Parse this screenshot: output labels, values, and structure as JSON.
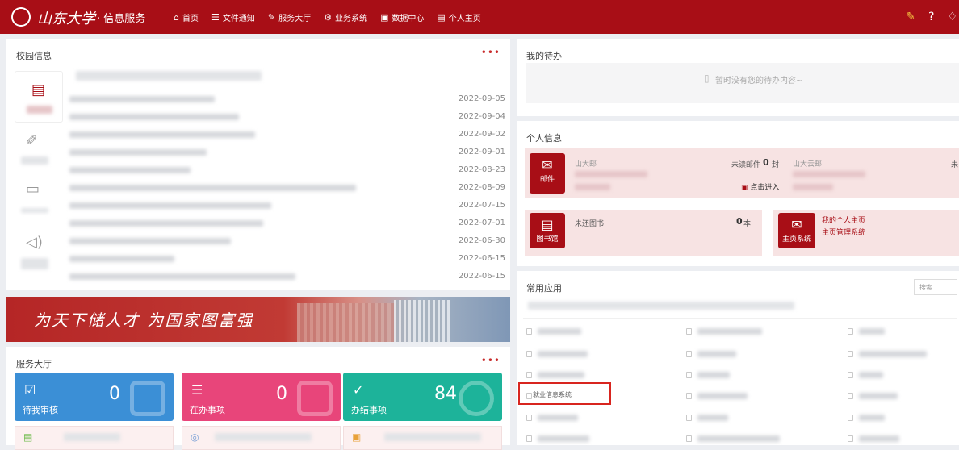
{
  "header": {
    "logo_name": "山东大学",
    "logo_sub": "· 信息服务",
    "nav": [
      {
        "icon": "home-icon",
        "glyph": "⌂",
        "label": "首页"
      },
      {
        "icon": "list-icon",
        "glyph": "☰",
        "label": "文件通知"
      },
      {
        "icon": "edit-icon",
        "glyph": "✎",
        "label": "服务大厅"
      },
      {
        "icon": "link-icon",
        "glyph": "⚙",
        "label": "业务系统"
      },
      {
        "icon": "monitor-icon",
        "glyph": "▣",
        "label": "数据中心"
      },
      {
        "icon": "page-icon",
        "glyph": "▤",
        "label": "个人主页"
      }
    ]
  },
  "campus": {
    "title": "校园信息",
    "more": "•••",
    "dates": [
      "2022-09-05",
      "2022-09-04",
      "2022-09-02",
      "2022-09-01",
      "2022-08-23",
      "2022-08-09",
      "2022-07-15",
      "2022-07-01",
      "2022-06-30",
      "2022-06-15",
      "2022-06-15"
    ]
  },
  "banner": {
    "text": "为天下储人才 为国家图富强"
  },
  "service": {
    "title": "服务大厅",
    "more": "•••",
    "cards": [
      {
        "label": "待我审核",
        "value": "0",
        "color": "#3b8fd6"
      },
      {
        "label": "在办事项",
        "value": "0",
        "color": "#e8457a"
      },
      {
        "label": "办结事项",
        "value": "84",
        "color": "#1db39a"
      }
    ]
  },
  "todo": {
    "title": "我的待办",
    "empty": "暂时没有您的待办内容~"
  },
  "personal": {
    "title": "个人信息",
    "mail": {
      "label": "邮件",
      "sender": "山大邮",
      "unread_label": "未读邮件",
      "unread_count": "0",
      "unread_unit": "封",
      "enter": "点击进入"
    },
    "mail2": {
      "sender": "山大云邮",
      "unread_label": "未"
    },
    "library": {
      "label": "图书馆",
      "text": "未还图书",
      "count": "0",
      "unit": "本"
    },
    "homepage": {
      "label": "主页系统",
      "line1": "我的个人主页",
      "line2": "主页管理系统"
    }
  },
  "apps": {
    "title": "常用应用",
    "search_placeholder": "搜索",
    "highlighted": "就业信息系统"
  },
  "colors": {
    "brand": "#a80e16",
    "highlight": "#d8251f"
  }
}
